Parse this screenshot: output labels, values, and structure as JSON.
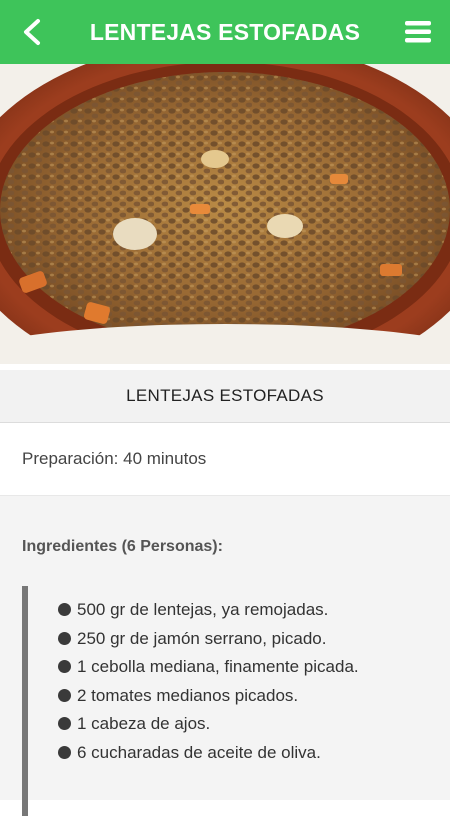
{
  "header": {
    "title": "LENTEJAS ESTOFADAS",
    "back_icon": "chevron-left-icon",
    "menu_icon": "hamburger-menu-icon",
    "bar_color": "#3ec45a"
  },
  "recipe": {
    "name": "LENTEJAS ESTOFADAS",
    "preparation": "Preparación: 40 minutos",
    "ingredients_heading": "Ingredientes (6 Personas):",
    "ingredients": [
      "500 gr de lentejas, ya remojadas.",
      "250 gr de jamón serrano, picado.",
      "1 cebolla mediana, finamente picada.",
      "2 tomates medianos picados.",
      "1 cabeza de ajos.",
      "6 cucharadas de aceite de oliva."
    ]
  }
}
